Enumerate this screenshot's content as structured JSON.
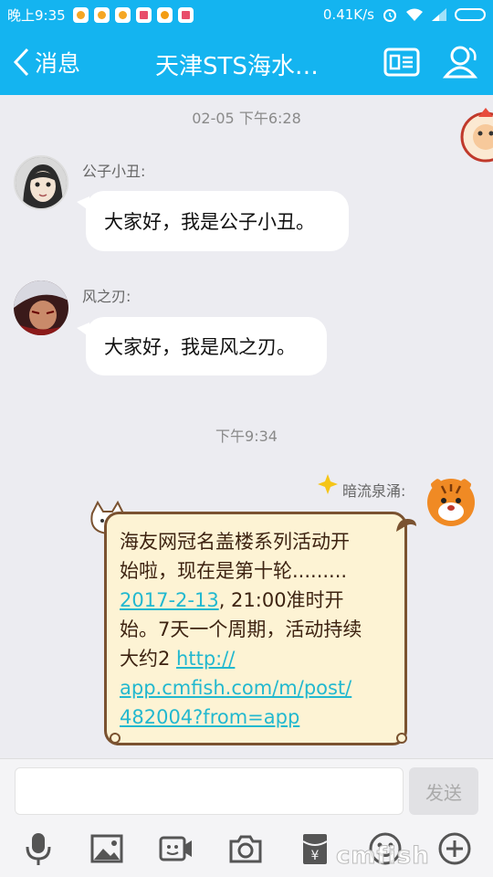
{
  "status_bar": {
    "time": "晚上9:35",
    "network_speed": "0.41K/s"
  },
  "nav": {
    "back_label": "消息",
    "title": "天津STS海水…"
  },
  "chat": {
    "timestamp_1": "02-05 下午6:28",
    "messages": [
      {
        "sender": "公子小丑:",
        "text": "大家好，我是公子小丑。"
      },
      {
        "sender": "风之刃:",
        "text": "大家好，我是风之刃。"
      }
    ],
    "timestamp_2": "下午9:34",
    "my_message": {
      "sender": "暗流泉涌:",
      "line1": "海友网冠名盖楼系列活动开",
      "line2": "始啦，现在是第十轮.........",
      "date_link": "2017-2-13",
      "line3_rest": ", 21:00准时开",
      "line4": "始。7天一个周期，活动持续",
      "line5_prefix": "大约2 ",
      "url_part1": "http://",
      "url_part2": "app.cmfish.com/m/post/",
      "url_part3": "482004?from=app"
    }
  },
  "input": {
    "send_label": "发送"
  },
  "watermark": "cmfish"
}
